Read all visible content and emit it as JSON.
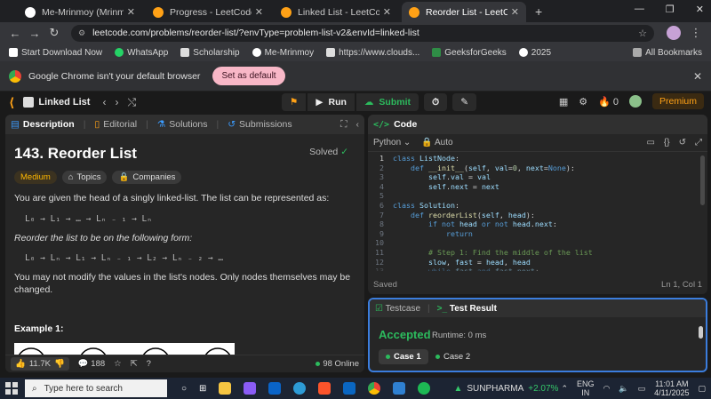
{
  "browser": {
    "tabs": [
      {
        "title": "Me-Mrinmoy (Mrinmoy Saman",
        "icon": "github-icon",
        "color": "#ffffff",
        "active": false
      },
      {
        "title": "Progress - LeetCode",
        "icon": "leetcode-icon",
        "color": "#ffa116",
        "active": false
      },
      {
        "title": "Linked List - LeetCode",
        "icon": "leetcode-icon",
        "color": "#ffa116",
        "active": false
      },
      {
        "title": "Reorder List - LeetCode",
        "icon": "leetcode-icon",
        "color": "#ffa116",
        "active": true
      }
    ],
    "url": "leetcode.com/problems/reorder-list/?envType=problem-list-v2&envId=linked-list",
    "bookmarks": [
      "Start Download Now",
      "WhatsApp",
      "Scholarship",
      "Me-Mrinmoy",
      "https://www.clouds...",
      "GeeksforGeeks",
      "2025"
    ],
    "all_bookmarks": "All Bookmarks",
    "infobar": {
      "message": "Google Chrome isn't your default browser",
      "button": "Set as default"
    }
  },
  "lc_nav": {
    "list_name": "Linked List",
    "run": "Run",
    "submit": "Submit",
    "streak": "0",
    "premium": "Premium"
  },
  "left_panel": {
    "tabs": [
      "Description",
      "Editorial",
      "Solutions",
      "Submissions"
    ],
    "title": "143. Reorder List",
    "solved": "Solved",
    "chips": [
      "Medium",
      "Topics",
      "Companies"
    ],
    "intro": "You are given the head of a singly linked-list. The list can be represented as:",
    "formula1": "L₀ → L₁ → … → Lₙ ₋ ₁ → Lₙ",
    "reorder": "Reorder the list to be on the following form:",
    "formula2": "L₀ → Lₙ → L₁ → Lₙ ₋ ₁ → L₂ → Lₙ ₋ ₂ → …",
    "constraint": "You may not modify the values in the list's nodes. Only nodes themselves may be changed.",
    "example_title": "Example 1:",
    "diagram_nodes": [
      "1",
      "2",
      "3",
      "4"
    ],
    "footer": {
      "likes": "11.7K",
      "comments": "188",
      "online": "98 Online"
    }
  },
  "code_panel": {
    "title": "Code",
    "language": "Python",
    "auto": "Auto",
    "saved": "Saved",
    "position": "Ln 1, Col 1"
  },
  "result_panel": {
    "tabs": [
      "Testcase",
      "Test Result"
    ],
    "status": "Accepted",
    "runtime": "Runtime: 0 ms",
    "cases": [
      "Case 1",
      "Case 2"
    ]
  },
  "taskbar": {
    "search_placeholder": "Type here to search",
    "stock_name": "SUNPHARMA",
    "stock_change": "+2.07%",
    "lang1": "ENG",
    "lang2": "IN",
    "time": "11:01 AM",
    "date": "4/11/2025"
  }
}
